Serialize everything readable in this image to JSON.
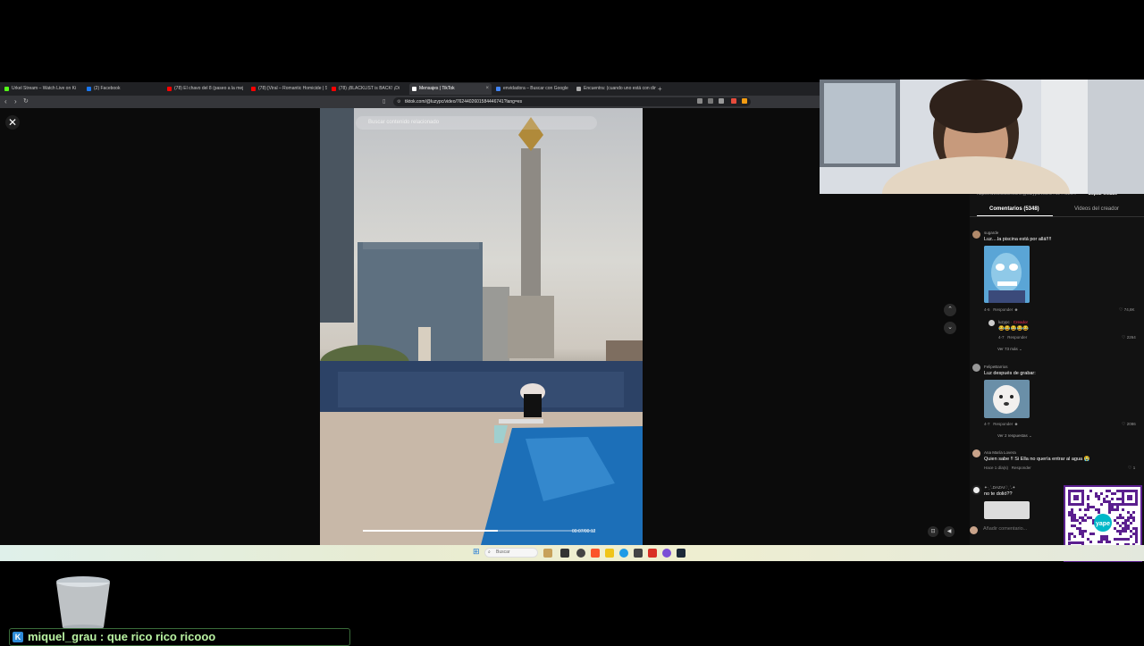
{
  "browser": {
    "tabs": [
      {
        "label": "Urkel Stream – Watch Live on Ki",
        "color": "#53fc18"
      },
      {
        "label": "(2) Facebook",
        "color": "#1877f2"
      },
      {
        "label": "(78) El chavo del 8 (paseo a la mej",
        "color": "#ff0000"
      },
      {
        "label": "(78) [Viral – Romantic Homicide | Su",
        "color": "#ff0000"
      },
      {
        "label": "(78) ¡BLACKLIST is BACK! ¡Di",
        "color": "#ff0000"
      },
      {
        "label": "Mensajes | TikTok",
        "color": "#ffffff",
        "active": true
      },
      {
        "label": "envidadora – Buscar con Google",
        "color": "#4285f4"
      },
      {
        "label": "Encuentra: (cuando uno está con din",
        "color": "#aaaaaa"
      }
    ],
    "new_tab": "+",
    "url": "tiktok.com/@luzypc/video/7624402601584446741?lang=es"
  },
  "player": {
    "close": "✕",
    "search_placeholder": "Buscar contenido relacionado",
    "timecode": "00:07/00:12",
    "progress": 0.58,
    "nav_up": "⌃",
    "nav_down": "⌄"
  },
  "panel": {
    "copy_link_url": "https://www.tiktok.com/@luzypc/video/76244026...",
    "copy_link": "Copiar enlace",
    "tabs": [
      "Comentarios (5348)",
      "Videos del creador"
    ],
    "comments": [
      {
        "user": "sugarde",
        "text": "Luz....la piscina está por allá!!!!",
        "meta": "4-6",
        "reply": "Responder",
        "likes": "74,8K"
      },
      {
        "user": "luzypc",
        "creator": "· Creador",
        "text": "😂😂😂😂😂",
        "meta": "4-7",
        "reply": "Responder",
        "likes": "2264"
      },
      {
        "more": "Ver 73 más ⌄"
      },
      {
        "user": "FelipeBarrios",
        "text": "Luz después de grabar:",
        "meta": "4-7",
        "reply": "Responder",
        "likes": "2086"
      },
      {
        "more": "Ver 2 respuestas ⌄"
      },
      {
        "user": "Ana María Lovera",
        "text": "Quien sabe !! Si Ella no quería entrar al agua 😭",
        "meta": "Hace 1 día(s)",
        "reply": "Responder",
        "likes": "1"
      },
      {
        "user": "✦·ˎˊ˗DAZAI♡ˎˊ˗✦",
        "text": "no te dolió??"
      }
    ],
    "comment_placeholder": "Añadir comentario..."
  },
  "taskbar": {
    "search": "Buscar"
  },
  "overlay": {
    "chat_user": "miquel_grau",
    "chat_message": "miquel_grau : que rico rico ricooo",
    "qr_label": "yape"
  }
}
